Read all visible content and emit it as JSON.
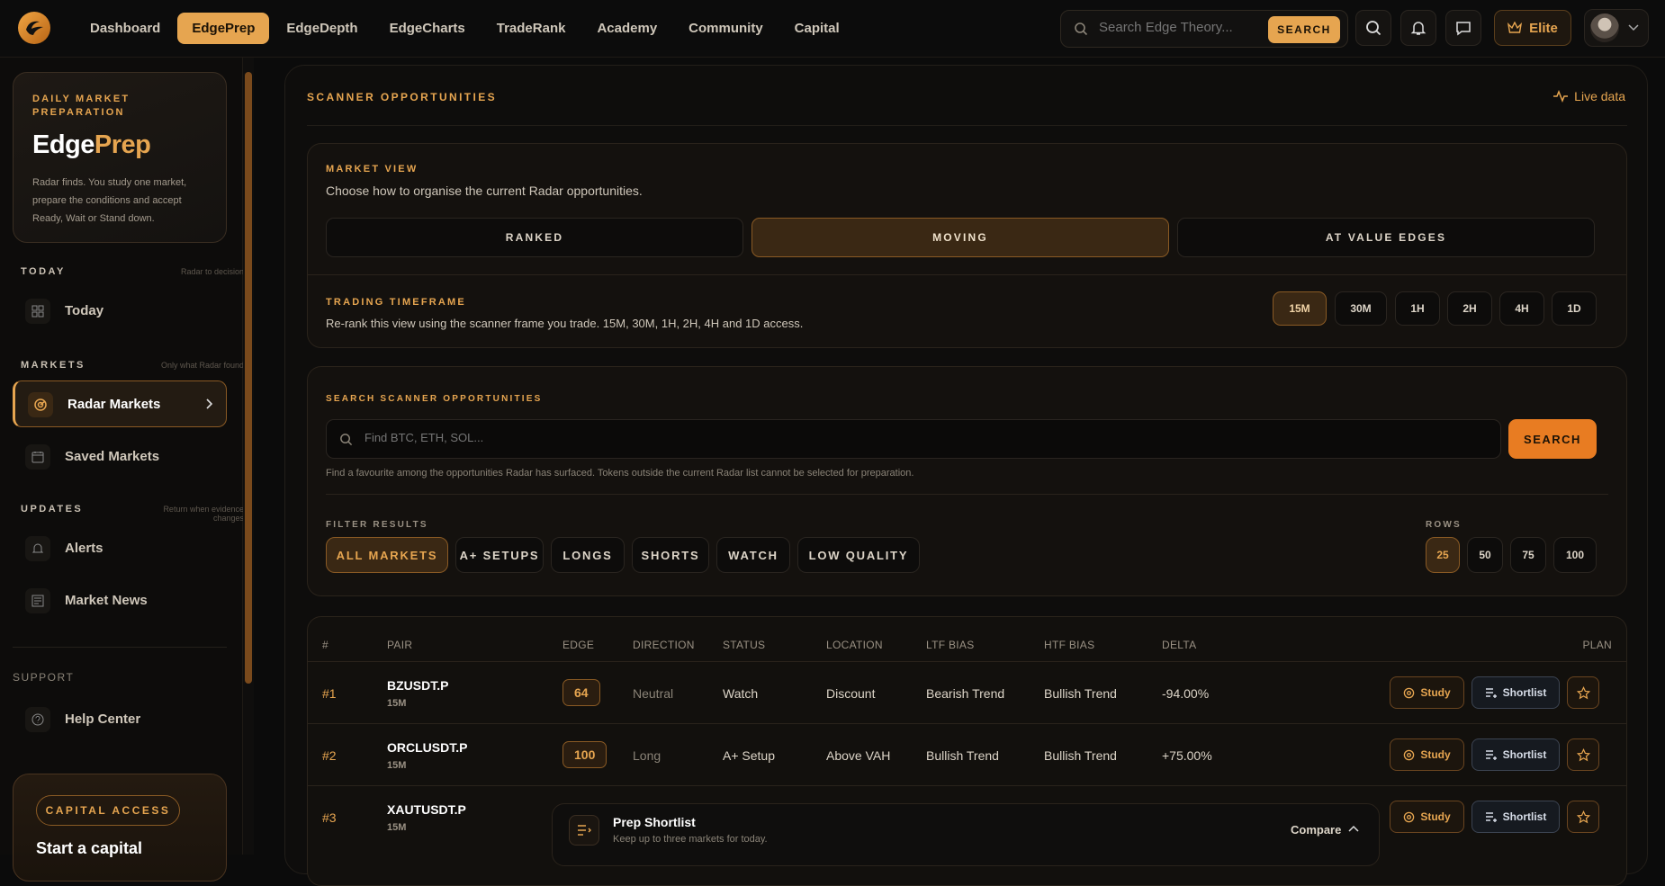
{
  "nav": [
    "Dashboard",
    "EdgePrep",
    "EdgeDepth",
    "EdgeCharts",
    "TradeRank",
    "Academy",
    "Community",
    "Capital"
  ],
  "top_search": {
    "placeholder": "Search Edge Theory...",
    "button": "SEARCH"
  },
  "elite_label": "Elite",
  "brand": {
    "kicker": "DAILY MARKET PREPARATION",
    "title_a": "Edge",
    "title_b": "Prep",
    "desc": "Radar finds. You study one market, prepare the conditions and accept Ready, Wait or Stand down."
  },
  "sidebar": {
    "today_head": "TODAY",
    "today_hint": "Radar to decision",
    "today_item": "Today",
    "markets_head": "MARKETS",
    "markets_hint": "Only what Radar found",
    "radar": "Radar Markets",
    "saved": "Saved Markets",
    "updates_head": "UPDATES",
    "updates_hint": "Return when evidence changes",
    "alerts": "Alerts",
    "news": "Market News",
    "support": "SUPPORT",
    "help": "Help Center",
    "cap_pill": "CAPITAL ACCESS",
    "cap_text": "Start a capital"
  },
  "main": {
    "title": "SCANNER OPPORTUNITIES",
    "live": "Live data",
    "view_label": "MARKET VIEW",
    "view_sub": "Choose how to organise the current Radar opportunities.",
    "views": [
      "RANKED",
      "MOVING",
      "AT VALUE EDGES"
    ],
    "tf_label": "TRADING TIMEFRAME",
    "tf_sub": "Re-rank this view using the scanner frame you trade. 15M, 30M, 1H, 2H, 4H and 1D access.",
    "timeframes": [
      "15M",
      "30M",
      "1H",
      "2H",
      "4H",
      "1D"
    ],
    "search_label": "SEARCH SCANNER OPPORTUNITIES",
    "search_placeholder": "Find BTC, ETH, SOL...",
    "search_button": "SEARCH",
    "search_note": "Find a favourite among the opportunities Radar has surfaced. Tokens outside the current Radar list cannot be selected for preparation.",
    "filter_label": "FILTER RESULTS",
    "filters": [
      "ALL MARKETS",
      "A+ SETUPS",
      "LONGS",
      "SHORTS",
      "WATCH",
      "LOW QUALITY"
    ],
    "rows_label": "ROWS",
    "rows": [
      "25",
      "50",
      "75",
      "100"
    ]
  },
  "table": {
    "headers": [
      "#",
      "PAIR",
      "EDGE",
      "DIRECTION",
      "STATUS",
      "LOCATION",
      "LTF BIAS",
      "HTF BIAS",
      "DELTA",
      "PLAN"
    ],
    "rows": [
      {
        "rank": "#1",
        "pair": "BZUSDT.P",
        "tf": "15M",
        "edge": "64",
        "direction": "Neutral",
        "status": "Watch",
        "location": "Discount",
        "ltf": "Bearish Trend",
        "htf": "Bullish Trend",
        "delta": "-94.00%"
      },
      {
        "rank": "#2",
        "pair": "ORCLUSDT.P",
        "tf": "15M",
        "edge": "100",
        "direction": "Long",
        "status": "A+ Setup",
        "location": "Above VAH",
        "ltf": "Bullish Trend",
        "htf": "Bullish Trend",
        "delta": "+75.00%"
      },
      {
        "rank": "#3",
        "pair": "XAUTUSDT.P",
        "tf": "15M",
        "edge": "",
        "direction": "",
        "status": "",
        "location": "",
        "ltf": "",
        "htf": "",
        "delta": ""
      }
    ],
    "study": "Study",
    "shortlist": "Shortlist"
  },
  "dock": {
    "title": "Prep Shortlist",
    "sub": "Keep up to three markets for today.",
    "compare": "Compare"
  }
}
